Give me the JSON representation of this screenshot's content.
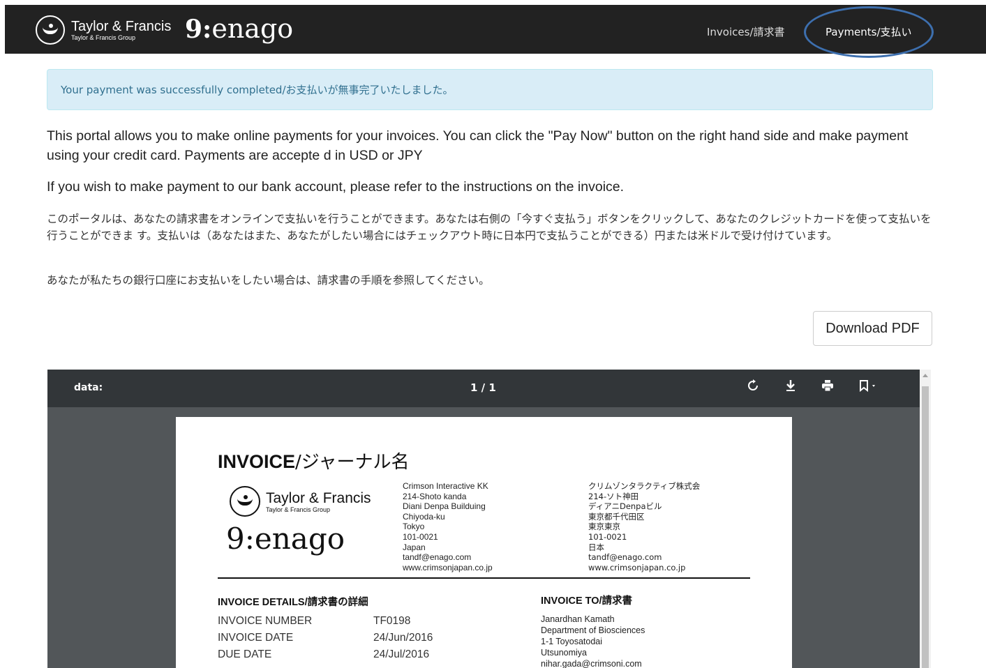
{
  "header": {
    "tf_name": "Taylor & Francis",
    "tf_sub": "Taylor & Francis Group",
    "enago_mark": "9:",
    "enago_name": "enago",
    "nav": [
      {
        "label": "Invoices/請求書"
      },
      {
        "label": "Payments/支払い"
      }
    ]
  },
  "alert": {
    "message": "Your payment was successfully completed/お支払いが無事完了いたしました。"
  },
  "intro": {
    "en_1": "This portal allows you to make online payments for your invoices. You can click the \"Pay Now\" button on the right hand side and make payment using your credit card. Payments are accepte d in USD or JPY",
    "en_2": "If you wish to make payment to our bank account, please refer to the instructions on the invoice.",
    "jp_1": "このポータルは、あなたの請求書をオンラインで支払いを行うことができます。あなたは右側の「今すぐ支払う」ボタンをクリックして、あなたのクレジットカードを使って支払いを行うことができま す。支払いは（あなたはまた、あなたがしたい場合にはチェックアウト時に日本円で支払うことができる）円または米ドルで受け付けています。",
    "jp_2": "あなたが私たちの銀行口座にお支払いをしたい場合は、請求書の手順を参照してください。"
  },
  "download_label": "Download PDF",
  "viewer": {
    "title": "data:",
    "pages": "1 / 1",
    "icons": [
      "rotate-icon",
      "download-icon",
      "print-icon",
      "bookmark-icon"
    ]
  },
  "invoice": {
    "title_bold": "INVOICE",
    "title_rest": "/ジャーナル名",
    "tf_name": "Taylor & Francis",
    "tf_sub": "Taylor & Francis Group",
    "enago": "9:enago",
    "address_en": [
      "Crimson Interactive KK",
      "214-Shoto kanda",
      "Diani Denpa Builduing",
      "Chiyoda-ku",
      "Tokyo",
      "101-0021",
      "Japan",
      "tandf@enago.com",
      "www.crimsonjapan.co.jp"
    ],
    "address_jp": [
      "クリムゾンタラクティブ株式会",
      "214-ソト神田",
      "ディアニDenpaビル",
      "東京都千代田区",
      "東京東京",
      "101-0021",
      "日本",
      "tandf@enago.com",
      "www.crimsonjapan.co.jp"
    ],
    "details_heading": "INVOICE DETAILS/請求書の詳細",
    "to_heading": "INVOICE TO/請求書",
    "details": [
      {
        "label": "INVOICE NUMBER",
        "value": "TF0198"
      },
      {
        "label": "INVOICE DATE",
        "value": "24/Jun/2016"
      },
      {
        "label": "DUE DATE",
        "value": "24/Jul/2016"
      }
    ],
    "to_lines": [
      "Janardhan Kamath",
      "Department of Biosciences",
      "1-1 Toyosatodai",
      "Utsunomiya",
      "nihar.gada@crimsoni.com"
    ]
  }
}
